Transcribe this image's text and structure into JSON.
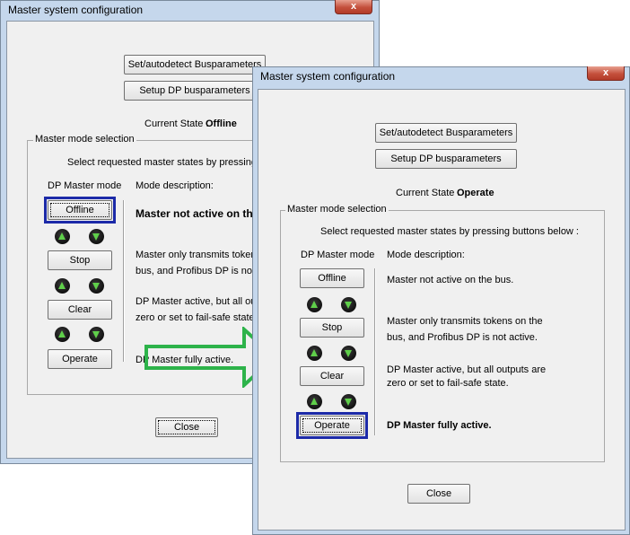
{
  "back_window": {
    "title": "Master system configuration",
    "close_glyph": "x",
    "buttons": {
      "set_autodetect": "Set/autodetect Busparameters",
      "setup_dp": "Setup DP busparameters"
    },
    "current_state_label": "Current State :",
    "current_state_value": "Offline",
    "group_title": "Master mode selection",
    "instruction": "Select requested master states by pressing butt",
    "column_left": "DP Master mode",
    "column_right": "Mode description:",
    "modes": [
      "Offline",
      "Stop",
      "Clear",
      "Operate"
    ],
    "descriptions": [
      [
        "Master not active on the"
      ],
      [
        "Master only transmits tokens c",
        "bus, and Profibus DP is not ac"
      ],
      [
        "DP Master active, but all outpu",
        "zero or set to fail-safe state."
      ],
      [
        "DP Master fully active."
      ]
    ],
    "close_button": "Close",
    "selected_mode": "Offline"
  },
  "front_window": {
    "title": "Master system configuration",
    "close_glyph": "x",
    "buttons": {
      "set_autodetect": "Set/autodetect Busparameters",
      "setup_dp": "Setup DP busparameters"
    },
    "current_state_label": "Current State :",
    "current_state_value": "Operate",
    "group_title": "Master mode selection",
    "instruction": "Select requested master states by pressing buttons below :",
    "column_left": "DP Master mode",
    "column_right": "Mode description:",
    "modes": [
      "Offline",
      "Stop",
      "Clear",
      "Operate"
    ],
    "descriptions": [
      [
        "Master not active on the bus."
      ],
      [
        "Master only transmits tokens on the",
        "bus, and Profibus DP is not active."
      ],
      [
        "DP Master active, but all outputs are",
        "zero or set to fail-safe state."
      ],
      [
        "DP Master fully active."
      ]
    ],
    "close_button": "Close",
    "selected_mode": "Operate"
  },
  "arrow": {
    "icon": "right-arrow-outline-icon",
    "color": "#2db34a"
  },
  "led_icons": [
    "up-arrow-led-icon",
    "down-arrow-led-icon"
  ]
}
